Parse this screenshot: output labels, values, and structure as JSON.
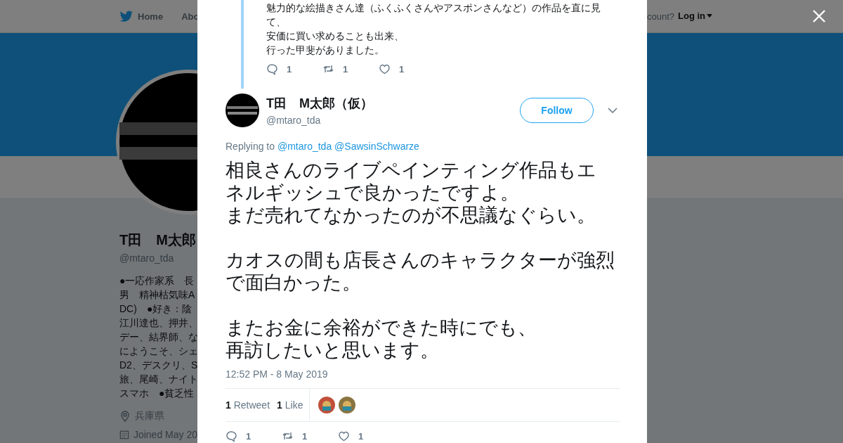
{
  "topbar": {
    "nav": [
      {
        "label": "Home",
        "kind": "bird",
        "selected": false
      },
      {
        "label": "Abo",
        "kind": "plain",
        "selected": false
      }
    ],
    "account_prompt": "count?",
    "login": "Log in"
  },
  "profile": {
    "name": "T田　M太郎",
    "handle": "@mtaro_tda",
    "bio_lines": [
      "●一応作家系　長",
      "男　精神枯気味A",
      "DC)　●好き：陰",
      "江川達也、押井、",
      "デー、結界師、な",
      "にようこそ、シェ",
      "D2、デスクリ、S",
      "旅、尾崎、ナイト",
      "スマホ　●貧乏性"
    ],
    "location": "兵庫県",
    "joined": "Joined May 20"
  },
  "modal": {
    "quoted": {
      "lines": [
        "魅力的な絵描きさん達（ふくふくさんやアスポンさんなど）の作品を直に見",
        "て、",
        "安価に買い求めることも出来、",
        "行った甲斐がありました。"
      ],
      "actions": [
        {
          "kind": "reply",
          "count": "1"
        },
        {
          "kind": "retweet",
          "count": "1"
        },
        {
          "kind": "like",
          "count": "1"
        }
      ]
    },
    "tweet": {
      "name": "T田　M太郎（仮）",
      "handle": "@mtaro_tda",
      "follow": "Follow",
      "replying_label": "Replying to",
      "replying_to": [
        "@mtaro_tda",
        "@SawsinSchwarze"
      ],
      "paragraphs": [
        [
          "相良さんのライブペインティング作品もエ",
          "ネルギッシュで良かったですよ。",
          "まだ売れてなかったのが不思議なぐらい。"
        ],
        [
          "カオスの間も店長さんのキャラクターが強烈",
          "で面白かった。"
        ],
        [
          "またお金に余裕ができた時にでも、",
          "再訪したいと思います。"
        ]
      ],
      "time": "12:52 PM - 8 May 2019",
      "stats": [
        {
          "count": "1",
          "label": "Retweet"
        },
        {
          "count": "1",
          "label": "Like"
        }
      ],
      "likers": [
        {
          "color": "#c0503a"
        },
        {
          "color": "#8a7440"
        }
      ],
      "actions": [
        {
          "kind": "reply",
          "count": "1"
        },
        {
          "kind": "retweet",
          "count": "1"
        },
        {
          "kind": "like",
          "count": "1"
        }
      ]
    }
  }
}
